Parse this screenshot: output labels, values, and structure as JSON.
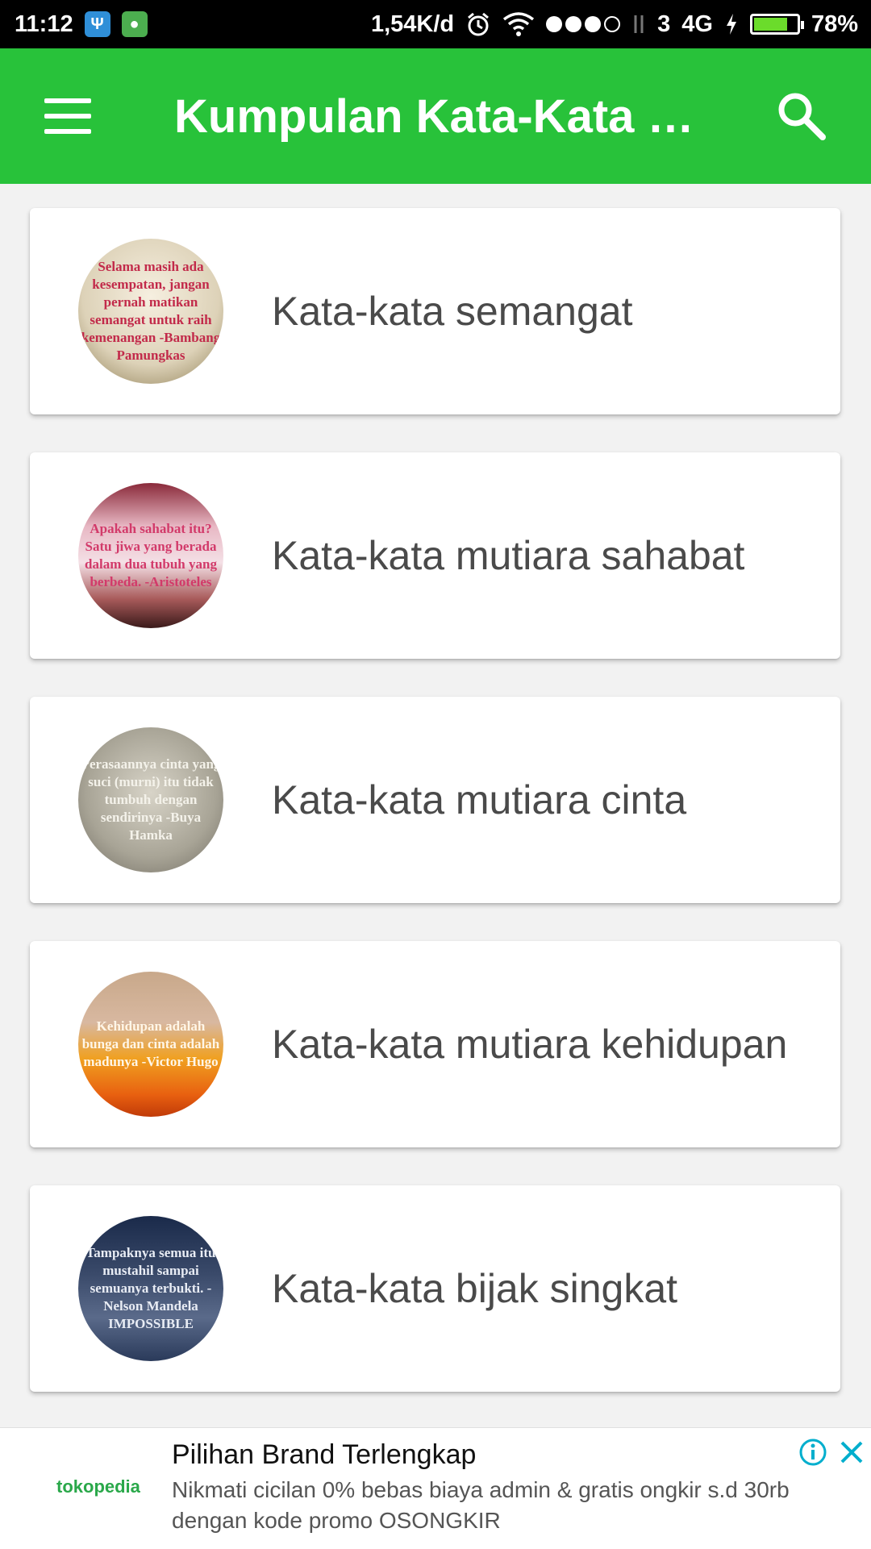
{
  "status_bar": {
    "time": "11:12",
    "speed": "1,54K/d",
    "sim": "3",
    "network": "4G",
    "battery": "78%",
    "battery_level": 0.78
  },
  "app_bar": {
    "title": "Kumpulan Kata-Kata In...",
    "color": "#28c23a"
  },
  "categories": [
    {
      "label": "Kata-kata semangat",
      "thumb_text": "Selama masih ada kesempatan, jangan pernah matikan semangat untuk raih kemenangan -Bambang Pamungkas"
    },
    {
      "label": "Kata-kata mutiara sahabat",
      "thumb_text": "Apakah sahabat itu? Satu jiwa yang berada dalam dua tubuh yang berbeda. -Aristoteles"
    },
    {
      "label": "Kata-kata mutiara cinta",
      "thumb_text": "Perasaannya cinta yang suci (murni) itu tidak tumbuh dengan sendirinya -Buya Hamka"
    },
    {
      "label": "Kata-kata mutiara kehidupan",
      "thumb_text": "Kehidupan adalah bunga dan cinta adalah madunya -Victor Hugo"
    },
    {
      "label": "Kata-kata bijak singkat",
      "thumb_text": "Tampaknya semua itu mustahil sampai semuanya terbukti. -Nelson Mandela IMPOSSIBLE"
    }
  ],
  "ad": {
    "brand": "tokopedia",
    "title": "Pilihan Brand Terlengkap",
    "body": "Nikmati cicilan 0% bebas biaya admin & gratis ongkir s.d 30rb dengan kode promo OSONGKIR"
  }
}
